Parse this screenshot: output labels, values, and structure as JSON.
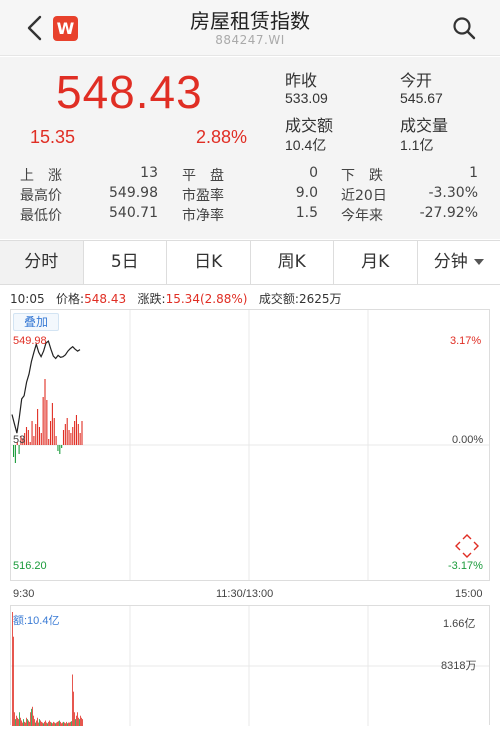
{
  "header": {
    "title": "房屋租赁指数",
    "code": "884247.WI",
    "logo_text": "W"
  },
  "quote": {
    "price": "548.43",
    "change": "15.35",
    "change_pct": "2.88%",
    "prev_close_label": "昨收",
    "prev_close": "533.09",
    "open_label": "今开",
    "open": "545.67",
    "turnover_label": "成交额",
    "turnover": "10.4亿",
    "volume_label": "成交量",
    "volume": "1.1亿"
  },
  "stats": {
    "up_label": "上　涨",
    "up": "13",
    "flat_label": "平　盘",
    "flat": "0",
    "down_label": "下　跌",
    "down": "1",
    "high_label": "最高价",
    "high": "549.98",
    "pe_label": "市盈率",
    "pe": "9.0",
    "d20_label": "近20日",
    "d20": "-3.30%",
    "low_label": "最低价",
    "low": "540.71",
    "pb_label": "市净率",
    "pb": "1.5",
    "ytd_label": "今年来",
    "ytd": "-27.92%"
  },
  "tabs": [
    "分时",
    "5日",
    "日K",
    "周K",
    "月K",
    "分钟"
  ],
  "infoline": {
    "time": "10:05",
    "price_label": "价格:",
    "price": "548.43",
    "chg_label": "涨跌:",
    "chg": "15.34(2.88%)",
    "amt_label": "成交额:",
    "amt": "2625万"
  },
  "chart": {
    "overlay_label": "叠加",
    "y_top": "549.98",
    "y_mid": "533.09",
    "y_mid_visible": "53",
    "y_bottom": "516.20",
    "pct_top": "3.17%",
    "pct_mid": "0.00%",
    "pct_bottom": "-3.17%",
    "x_start": "9:30",
    "x_mid": "11:30/13:00",
    "x_end": "15:00",
    "vol_label": "额:10.4亿",
    "vol_top": "1.66亿",
    "vol_mid": "8318万",
    "colors": {
      "up": "#e02e24",
      "down": "#1a9b3b",
      "line": "#222222"
    }
  },
  "chart_data": {
    "type": "line",
    "price_series": [
      538.0,
      536.5,
      535.0,
      537.5,
      540.5,
      541.0,
      543.2,
      544.5,
      546.5,
      548.0,
      549.3,
      548.0,
      547.3,
      548.2,
      549.5,
      549.8,
      548.5,
      547.4,
      547.0,
      547.5,
      547.2,
      547.3,
      547.6,
      548.2,
      548.6,
      548.9,
      548.5,
      548.2,
      548.43
    ],
    "ylim": [
      516.2,
      549.98
    ],
    "prev_close": 533.09,
    "breadth_bars": [
      -4,
      -6,
      1,
      -3,
      3,
      2,
      4,
      6,
      5,
      1,
      8,
      3,
      7,
      12,
      6,
      4,
      16,
      22,
      15,
      2,
      8,
      14,
      9,
      3,
      -2,
      -3,
      -1,
      5,
      7,
      9,
      5,
      4,
      6,
      8,
      10,
      7,
      4,
      8
    ],
    "volume_bars": [
      1.66,
      1.3,
      0.2,
      0.1,
      0.15,
      0.12,
      0.1,
      0.2,
      0.12,
      0.08,
      0.05,
      0.1,
      0.06,
      0.05,
      0.12,
      0.1,
      0.08,
      0.06,
      0.2,
      0.25,
      0.28,
      0.15,
      0.1,
      0.05,
      0.08,
      0.12,
      0.05,
      0.1,
      0.08,
      0.06,
      0.05,
      0.04,
      0.06,
      0.08,
      0.05,
      0.04,
      0.06,
      0.08,
      0.06,
      0.05,
      0.04,
      0.06,
      0.05,
      0.04,
      0.05,
      0.06,
      0.07,
      0.08,
      0.06,
      0.04,
      0.05,
      0.06,
      0.05,
      0.04,
      0.06,
      0.04,
      0.05,
      0.05,
      0.06,
      0.07,
      0.75,
      0.5,
      0.2,
      0.1,
      0.15,
      0.2,
      0.12,
      0.1,
      0.15,
      0.12,
      0.1
    ],
    "volume_max": 1.66
  }
}
